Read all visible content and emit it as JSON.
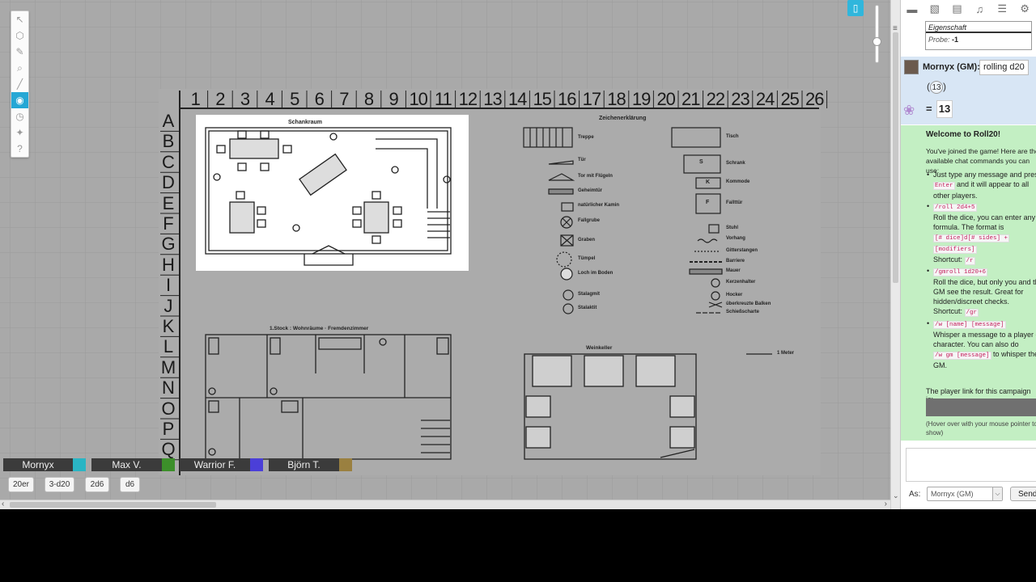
{
  "map": {
    "columns": [
      "1",
      "2",
      "3",
      "4",
      "5",
      "6",
      "7",
      "8",
      "9",
      "10",
      "11",
      "12",
      "13",
      "14",
      "15",
      "16",
      "17",
      "18",
      "19",
      "20",
      "21",
      "22",
      "23",
      "24",
      "25",
      "26"
    ],
    "rows": [
      "A",
      "B",
      "C",
      "D",
      "E",
      "F",
      "G",
      "H",
      "I",
      "J",
      "K",
      "L",
      "M",
      "N",
      "O",
      "P",
      "Q"
    ],
    "rooms": {
      "schankraum": "Schankraum",
      "legend_title": "Zeichenerklärung",
      "stock1": "1.Stock : Wohnräume · Fremdenzimmer",
      "weinkeller": "Weinkeller"
    },
    "legend_left": [
      "Treppe",
      "Tür",
      "Tor mit Flügeln",
      "Geheimtür",
      "natürlicher Kamin",
      "Fallgrube",
      "Graben",
      "Tümpel",
      "Loch im Boden",
      "Stalagmit",
      "Stalaktit"
    ],
    "legend_right": [
      "Tisch",
      "Schrank",
      "Kommode",
      "Fallttür",
      "Stuhl",
      "Vorhang",
      "Gitterstangen",
      "Barriere",
      "Mauer",
      "Kerzenhalter",
      "Hocker",
      "überkreuzte Balken",
      "Schießscharte"
    ],
    "legend_symbols": {
      "schrank": "S",
      "kommode": "K",
      "falltuer": "F"
    },
    "scale_label": "1 Meter"
  },
  "players": [
    {
      "name": "Mornyx",
      "color": "#2ab5c4"
    },
    {
      "name": "Max V.",
      "color": "#3c8f2a"
    },
    {
      "name": "Warrior F.",
      "color": "#4b3fd8"
    },
    {
      "name": "Björn T.",
      "color": "#9a8040"
    }
  ],
  "macros": [
    "20er",
    "3-d20",
    "2d6",
    "d6"
  ],
  "toolbar_icons": [
    "select-icon",
    "map-layer-icon",
    "draw-icon",
    "zoom-icon",
    "ruler-icon",
    "fog-icon",
    "turn-order-icon",
    "dice-icon",
    "help-icon"
  ],
  "sidebar_tabs": [
    "chat-icon",
    "art-library-icon",
    "journal-icon",
    "jukebox-icon",
    "compendium-icon",
    "settings-icon"
  ],
  "chat": {
    "attribute_label": "Eigenschaft",
    "probe_label": "Probe:",
    "probe_value": "-1",
    "gm_name": "Mornyx (GM):",
    "gm_message": "rolling d20",
    "roll_die": "13",
    "roll_open": "(",
    "roll_close": ")",
    "equals": "=",
    "roll_total": "13",
    "welcome_title": "Welcome to Roll20!",
    "welcome_intro": "You've joined the game! Here are the available chat commands you can use:",
    "cmd1_text_a": "Just type any message and press",
    "cmd1_code": "Enter",
    "cmd1_text_b": "and it will appear to all other players.",
    "cmd2_code": "/roll 2d4+5",
    "cmd2_text": "Roll the dice, you can enter any formula. The format is",
    "cmd2_format_a": "[# dice]d[# sides] +",
    "cmd2_format_b": "[modifiers]",
    "cmd2_shortcut": "Shortcut:",
    "cmd2_shortcut_code": "/r",
    "cmd3_code": "/gmroll 1d20+6",
    "cmd3_text": "Roll the dice, but only you and the GM see the result. Great for hidden/discreet checks.",
    "cmd3_shortcut": "Shortcut:",
    "cmd3_shortcut_code": "/gr",
    "cmd4_code": "/w [name] [message]",
    "cmd4_text": "Whisper a message to a player or character. You can also do",
    "cmd4_code2": "/w gm [message]",
    "cmd4_text_b": "to whisper the GM.",
    "player_link": "The player link for this campaign is:",
    "hover_note": "(Hover over with your mouse pointer to show)",
    "as_label": "As:",
    "as_value": "Mornyx (GM)",
    "send_label": "Send"
  }
}
